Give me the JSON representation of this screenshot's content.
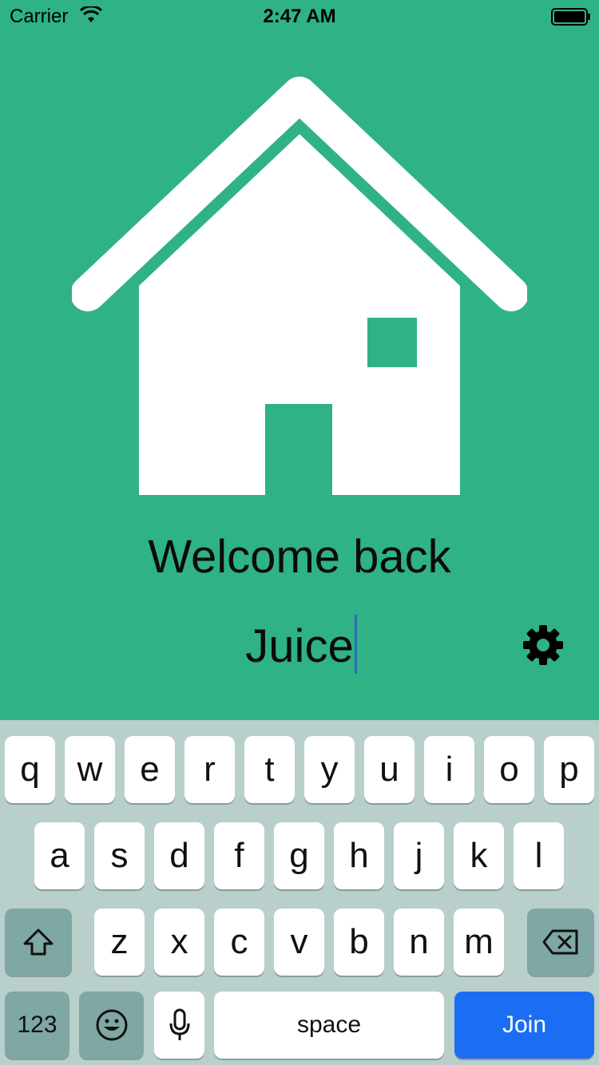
{
  "status_bar": {
    "carrier": "Carrier",
    "time": "2:47 AM"
  },
  "main": {
    "welcome_text": "Welcome back",
    "name_value": "Juice"
  },
  "keyboard": {
    "row1": [
      "q",
      "w",
      "e",
      "r",
      "t",
      "y",
      "u",
      "i",
      "o",
      "p"
    ],
    "row2": [
      "a",
      "s",
      "d",
      "f",
      "g",
      "h",
      "j",
      "k",
      "l"
    ],
    "row3": [
      "z",
      "x",
      "c",
      "v",
      "b",
      "n",
      "m"
    ],
    "numbers_label": "123",
    "space_label": "space",
    "return_label": "Join"
  },
  "colors": {
    "background": "#2fb286",
    "keyboard_background": "#b9cfcc",
    "join_button": "#1b6ef3"
  }
}
